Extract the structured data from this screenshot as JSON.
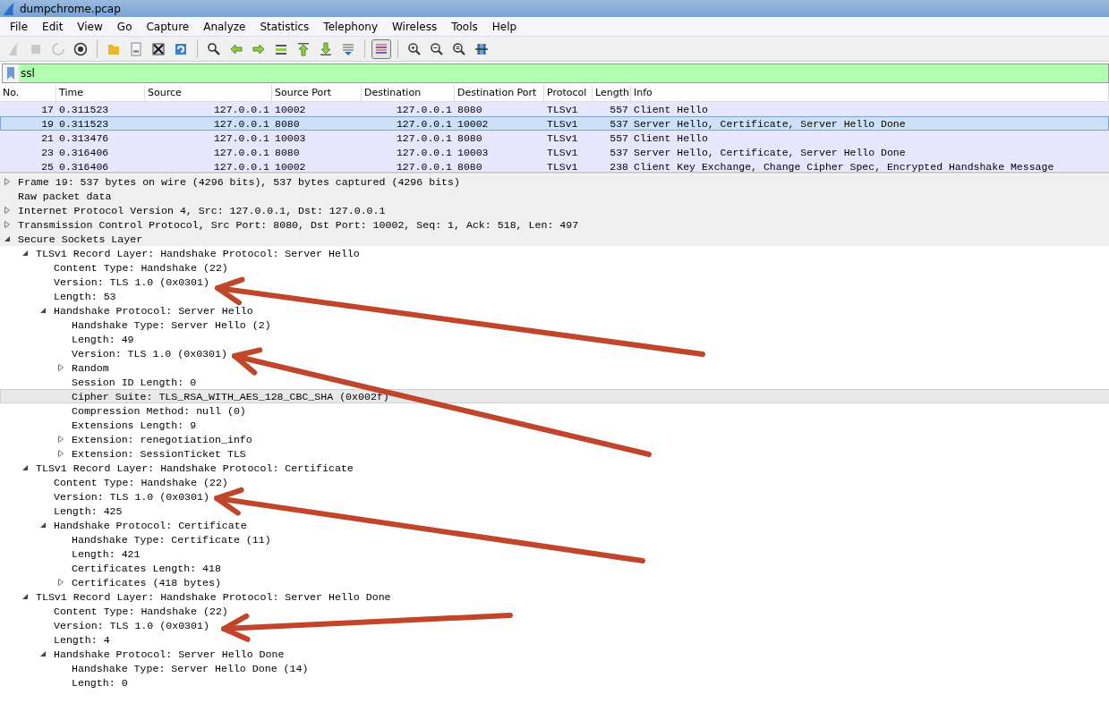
{
  "window": {
    "title": "dumpchrome.pcap"
  },
  "menu": [
    "File",
    "Edit",
    "View",
    "Go",
    "Capture",
    "Analyze",
    "Statistics",
    "Telephony",
    "Wireless",
    "Tools",
    "Help"
  ],
  "toolbar": [
    {
      "disabled": true,
      "pressed": false
    },
    {
      "disabled": true,
      "pressed": false
    },
    {
      "disabled": true,
      "pressed": false
    },
    {
      "disabled": false,
      "pressed": false
    },
    {
      "disabled": false,
      "pressed": false
    },
    {
      "disabled": false,
      "pressed": false
    },
    {
      "disabled": false,
      "pressed": false
    },
    {
      "disabled": false,
      "pressed": false
    },
    {
      "disabled": false,
      "pressed": false
    },
    {
      "disabled": false,
      "pressed": false
    },
    {
      "disabled": false,
      "pressed": false
    },
    {
      "disabled": false,
      "pressed": false
    },
    {
      "disabled": false,
      "pressed": false
    },
    {
      "disabled": false,
      "pressed": false
    },
    {
      "disabled": false,
      "pressed": false
    },
    {
      "disabled": false,
      "pressed": true
    },
    {
      "disabled": false,
      "pressed": false
    },
    {
      "disabled": false,
      "pressed": false
    },
    {
      "disabled": false,
      "pressed": false
    },
    {
      "disabled": false,
      "pressed": false
    }
  ],
  "filter": {
    "value": "ssl"
  },
  "packet_list": {
    "columns": [
      "No.",
      "Time",
      "Source",
      "Source Port",
      "Destination",
      "Destination Port",
      "Protocol",
      "Length",
      "Info"
    ],
    "rows": [
      {
        "cells": [
          "17",
          "0.311523",
          "127.0.0.1",
          "10002",
          "127.0.0.1",
          "8080",
          "TLSv1",
          "557",
          "Client Hello"
        ],
        "selected": false
      },
      {
        "cells": [
          "19",
          "0.311523",
          "127.0.0.1",
          "8080",
          "127.0.0.1",
          "10002",
          "TLSv1",
          "537",
          "Server Hello, Certificate, Server Hello Done"
        ],
        "selected": true
      },
      {
        "cells": [
          "21",
          "0.313476",
          "127.0.0.1",
          "10003",
          "127.0.0.1",
          "8080",
          "TLSv1",
          "557",
          "Client Hello"
        ],
        "selected": false
      },
      {
        "cells": [
          "23",
          "0.316406",
          "127.0.0.1",
          "8080",
          "127.0.0.1",
          "10003",
          "TLSv1",
          "537",
          "Server Hello, Certificate, Server Hello Done"
        ],
        "selected": false
      },
      {
        "cells": [
          "25",
          "0.316406",
          "127.0.0.1",
          "10002",
          "127.0.0.1",
          "8080",
          "TLSv1",
          "238",
          "Client Key Exchange, Change Cipher Spec, Encrypted Handshake Message"
        ],
        "selected": false
      }
    ]
  },
  "details": [
    {
      "text": "Frame 19: 537 bytes on wire (4296 bits), 537 bytes captured (4296 bits)",
      "kind": "branch",
      "expanded": false,
      "selected": false
    },
    {
      "text": "Raw packet data",
      "kind": "leaf",
      "selected": false
    },
    {
      "text": "Internet Protocol Version 4, Src: 127.0.0.1, Dst: 127.0.0.1",
      "kind": "branch",
      "expanded": false,
      "selected": false
    },
    {
      "text": "Transmission Control Protocol, Src Port: 8080, Dst Port: 10002, Seq: 1, Ack: 518, Len: 497",
      "kind": "branch",
      "expanded": false,
      "selected": false
    },
    {
      "text": "Secure Sockets Layer",
      "kind": "branch",
      "expanded": true,
      "selected": false,
      "children": [
        {
          "text": "TLSv1 Record Layer: Handshake Protocol: Server Hello",
          "kind": "branch",
          "expanded": true,
          "selected": false,
          "children": [
            {
              "text": "Content Type: Handshake (22)",
              "kind": "leaf",
              "selected": false
            },
            {
              "text": "Version: TLS 1.0 (0x0301)",
              "kind": "leaf",
              "selected": false
            },
            {
              "text": "Length: 53",
              "kind": "leaf",
              "selected": false
            },
            {
              "text": "Handshake Protocol: Server Hello",
              "kind": "branch",
              "expanded": true,
              "selected": false,
              "children": [
                {
                  "text": "Handshake Type: Server Hello (2)",
                  "kind": "leaf",
                  "selected": false
                },
                {
                  "text": "Length: 49",
                  "kind": "leaf",
                  "selected": false
                },
                {
                  "text": "Version: TLS 1.0 (0x0301)",
                  "kind": "leaf",
                  "selected": false
                },
                {
                  "text": "Random",
                  "kind": "branch",
                  "expanded": false,
                  "selected": false
                },
                {
                  "text": "Session ID Length: 0",
                  "kind": "leaf",
                  "selected": false
                },
                {
                  "text": "Cipher Suite: TLS_RSA_WITH_AES_128_CBC_SHA (0x002f)",
                  "kind": "leaf",
                  "selected": true
                },
                {
                  "text": "Compression Method: null (0)",
                  "kind": "leaf",
                  "selected": false
                },
                {
                  "text": "Extensions Length: 9",
                  "kind": "leaf",
                  "selected": false
                },
                {
                  "text": "Extension: renegotiation_info",
                  "kind": "branch",
                  "expanded": false,
                  "selected": false
                },
                {
                  "text": "Extension: SessionTicket TLS",
                  "kind": "branch",
                  "expanded": false,
                  "selected": false
                }
              ]
            }
          ]
        },
        {
          "text": "TLSv1 Record Layer: Handshake Protocol: Certificate",
          "kind": "branch",
          "expanded": true,
          "selected": false,
          "children": [
            {
              "text": "Content Type: Handshake (22)",
              "kind": "leaf",
              "selected": false
            },
            {
              "text": "Version: TLS 1.0 (0x0301)",
              "kind": "leaf",
              "selected": false
            },
            {
              "text": "Length: 425",
              "kind": "leaf",
              "selected": false
            },
            {
              "text": "Handshake Protocol: Certificate",
              "kind": "branch",
              "expanded": true,
              "selected": false,
              "children": [
                {
                  "text": "Handshake Type: Certificate (11)",
                  "kind": "leaf",
                  "selected": false
                },
                {
                  "text": "Length: 421",
                  "kind": "leaf",
                  "selected": false
                },
                {
                  "text": "Certificates Length: 418",
                  "kind": "leaf",
                  "selected": false
                },
                {
                  "text": "Certificates (418 bytes)",
                  "kind": "branch",
                  "expanded": false,
                  "selected": false
                }
              ]
            }
          ]
        },
        {
          "text": "TLSv1 Record Layer: Handshake Protocol: Server Hello Done",
          "kind": "branch",
          "expanded": true,
          "selected": false,
          "children": [
            {
              "text": "Content Type: Handshake (22)",
              "kind": "leaf",
              "selected": false
            },
            {
              "text": "Version: TLS 1.0 (0x0301)",
              "kind": "leaf",
              "selected": false
            },
            {
              "text": "Length: 4",
              "kind": "leaf",
              "selected": false
            },
            {
              "text": "Handshake Protocol: Server Hello Done",
              "kind": "branch",
              "expanded": true,
              "selected": false,
              "children": [
                {
                  "text": "Handshake Type: Server Hello Done (14)",
                  "kind": "leaf",
                  "selected": false
                },
                {
                  "text": "Length: 0",
                  "kind": "leaf",
                  "selected": false
                }
              ]
            }
          ]
        }
      ]
    }
  ]
}
